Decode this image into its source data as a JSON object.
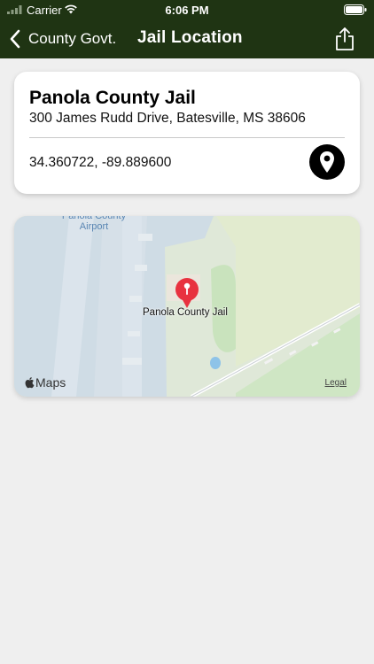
{
  "status_bar": {
    "carrier": "Carrier",
    "time": "6:06 PM"
  },
  "nav": {
    "back_label": "County Govt.",
    "title": "Jail Location"
  },
  "location": {
    "name": "Panola County Jail",
    "address": "300 James Rudd Drive, Batesville, MS 38606",
    "coordinates": "34.360722, -89.889600"
  },
  "map": {
    "airport_label": "Panola County\nAirport",
    "marker_label": "Panola County Jail",
    "brand": "Maps",
    "legal": "Legal"
  },
  "colors": {
    "nav_background": "#1f3413",
    "marker": "#e8323f",
    "map_land": "#dfe8d8",
    "map_airport": "#cfdce5"
  },
  "icons": [
    "signal-icon",
    "wifi-icon",
    "battery-icon",
    "chevron-left-icon",
    "share-icon",
    "location-pin-icon",
    "map-marker-icon",
    "apple-logo-icon"
  ]
}
